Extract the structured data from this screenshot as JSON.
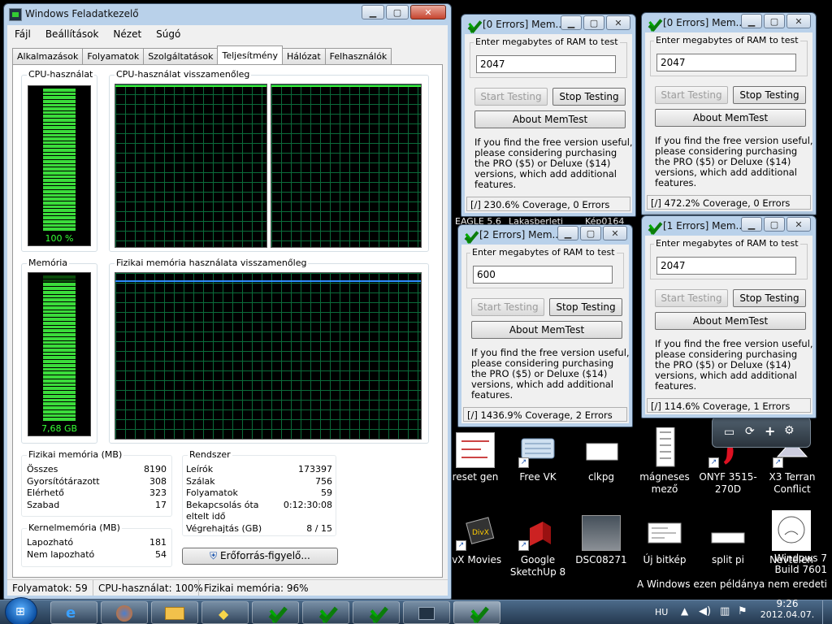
{
  "desktop": {
    "icons": [
      {
        "label": "reset gen",
        "icon": "reset-gen-icon"
      },
      {
        "label": "Free VK",
        "icon": "keyboard-icon"
      },
      {
        "label": "clkpg",
        "icon": "document-icon"
      },
      {
        "label": "mágneses mező",
        "icon": "image-icon"
      },
      {
        "label": "ONYF 3515-270D",
        "icon": "pdf-icon"
      },
      {
        "label": "X3 Terran Conflict",
        "icon": "game-icon"
      },
      {
        "label": "ivX Movies",
        "icon": "divx-icon"
      },
      {
        "label": "Google SketchUp 8",
        "icon": "sketchup-icon"
      },
      {
        "label": "DSC08271",
        "icon": "photo-icon"
      },
      {
        "label": "Új bitkép",
        "icon": "bitmap-icon"
      },
      {
        "label": "split pi",
        "icon": "split-icon"
      },
      {
        "label": "Nevtelen",
        "icon": "face-icon"
      }
    ],
    "hidden_labels": [
      "EAGLE 5.6",
      "Lakasberleti",
      "Kép0164"
    ],
    "watermark_line1": "Windows 7",
    "watermark_line2": "Build 7601",
    "watermark_line3": "A Windows ezen példánya nem eredeti"
  },
  "task_manager": {
    "title": "Windows Feladatkezelő",
    "menu": [
      "Fájl",
      "Beállítások",
      "Nézet",
      "Súgó"
    ],
    "tabs": [
      "Alkalmazások",
      "Folyamatok",
      "Szolgáltatások",
      "Teljesítmény",
      "Hálózat",
      "Felhasználók"
    ],
    "active_tab": "Teljesítmény",
    "cpu_usage_title": "CPU-használat",
    "cpu_usage_value": "100 %",
    "cpu_usage_fraction": 1.0,
    "cpu_history_title": "CPU-használat visszamenőleg",
    "memory_title": "Memória",
    "memory_value": "7,68 GB",
    "memory_fraction": 0.96,
    "memory_history_title": "Fizikai memória használata visszamenőleg",
    "physical_memory": {
      "title": "Fizikai memória (MB)",
      "rows": [
        {
          "label": "Összes",
          "value": "8190"
        },
        {
          "label": "Gyorsítótárazott",
          "value": "308"
        },
        {
          "label": "Elérhető",
          "value": "323"
        },
        {
          "label": "Szabad",
          "value": "17"
        }
      ]
    },
    "kernel_memory": {
      "title": "Kernelmemória (MB)",
      "rows": [
        {
          "label": "Lapozható",
          "value": "181"
        },
        {
          "label": "Nem lapozható",
          "value": "54"
        }
      ]
    },
    "system": {
      "title": "Rendszer",
      "rows": [
        {
          "label": "Leírók",
          "value": "173397"
        },
        {
          "label": "Szálak",
          "value": "756"
        },
        {
          "label": "Folyamatok",
          "value": "59"
        },
        {
          "label": "Bekapcsolás óta",
          "value": "0:12:30:08"
        },
        {
          "label": "eltelt idő",
          "value": ""
        },
        {
          "label": "Végrehajtás (GB)",
          "value": "8 / 15"
        }
      ]
    },
    "resource_monitor_button": "Erőforrás-figyelő...",
    "status": {
      "processes": "Folyamatok: 59",
      "cpu": "CPU-használat: 100%",
      "memory": "Fizikai memória: 96%"
    }
  },
  "memtest_common": {
    "group_label": "Enter megabytes of RAM to test",
    "start_button": "Start Testing",
    "stop_button": "Stop Testing",
    "about_button": "About MemTest",
    "info_text": "If you find the free version useful, please considering purchasing the PRO ($5) or Deluxe ($14) versions, which add additional features."
  },
  "memtest_windows": [
    {
      "title": "[0 Errors] Mem...",
      "ram": "2047",
      "status": "[/]   230.6% Coverage, 0 Errors"
    },
    {
      "title": "[0 Errors] Mem...",
      "ram": "2047",
      "status": "[/]   472.2% Coverage, 0 Errors"
    },
    {
      "title": "[2 Errors] Mem...",
      "ram": "600",
      "status": "[/]   1436.9% Coverage, 2 Errors"
    },
    {
      "title": "[1 Errors] Mem...",
      "ram": "2047",
      "status": "[/]   114.6% Coverage, 1 Errors"
    }
  ],
  "taskbar": {
    "language": "HU",
    "time": "9:26",
    "date": "2012.04.07."
  }
}
